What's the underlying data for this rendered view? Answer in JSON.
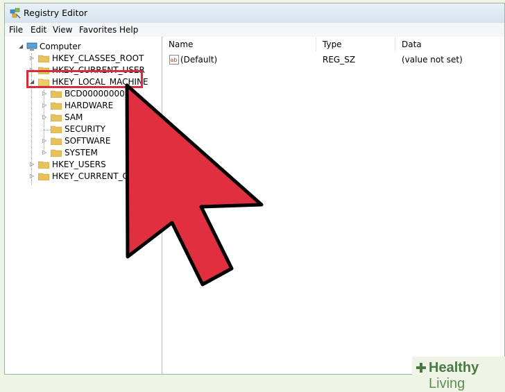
{
  "window": {
    "title": "Registry Editor"
  },
  "menu": [
    "File",
    "Edit",
    "View",
    "Favorites",
    "Help"
  ],
  "tree": {
    "root": "Computer",
    "nodes": [
      {
        "label": "HKEY_CLASSES_ROOT"
      },
      {
        "label": "HKEY_CURRENT_USER"
      },
      {
        "label": "HKEY_LOCAL_MACHINE"
      },
      {
        "label": "BCD00000000"
      },
      {
        "label": "HARDWARE"
      },
      {
        "label": "SAM"
      },
      {
        "label": "SECURITY"
      },
      {
        "label": "SOFTWARE"
      },
      {
        "label": "SYSTEM"
      },
      {
        "label": "HKEY_USERS"
      },
      {
        "label": "HKEY_CURRENT_CONFIG"
      }
    ]
  },
  "list": {
    "columns": [
      "Name",
      "Type",
      "Data"
    ],
    "rows": [
      {
        "name": "(Default)",
        "type": "REG_SZ",
        "data": "(value not set)",
        "icon": "ab"
      }
    ]
  },
  "watermark": {
    "brand_a": "Healthy",
    "brand_b": " Living"
  },
  "colors": {
    "highlight": "#d62c3d",
    "pointer": "#e0303f",
    "watermark": "#4a7a44"
  }
}
